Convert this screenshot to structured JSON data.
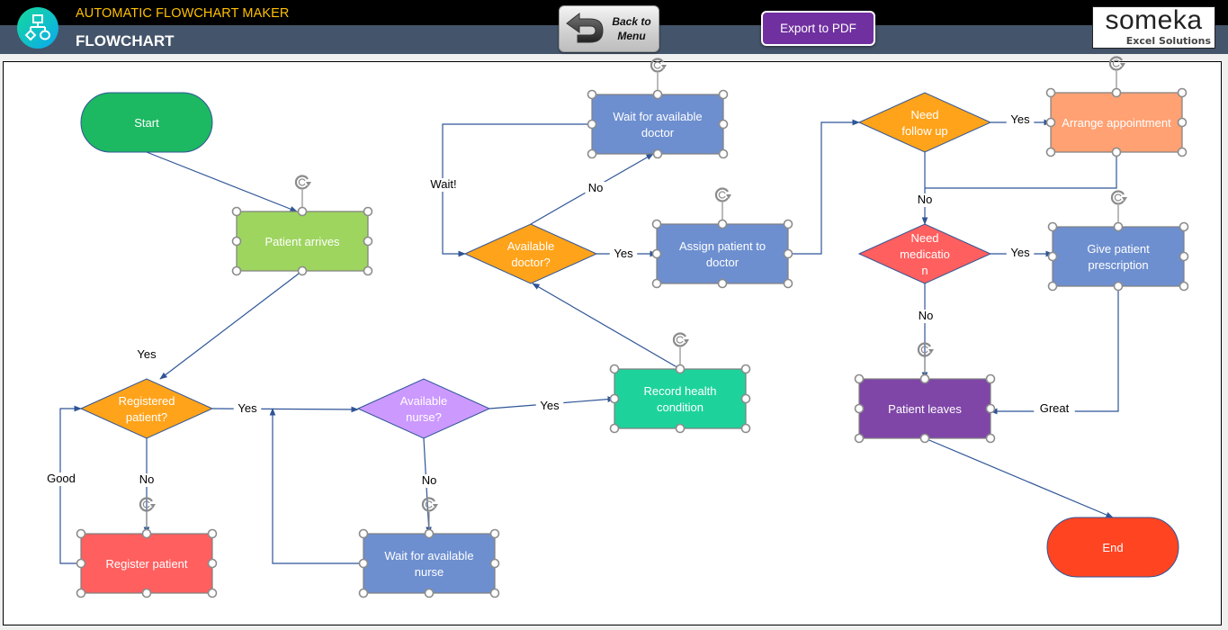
{
  "header": {
    "app_title": "AUTOMATIC FLOWCHART MAKER",
    "page_title": "FLOWCHART",
    "back_button_label": [
      "Back to",
      "Menu"
    ],
    "export_button_label": "Export to PDF",
    "brand_name": "someka",
    "brand_tagline": "Excel Solutions"
  },
  "colors": {
    "green_terminal": "#1db862",
    "light_green": "#9ed55f",
    "orange": "#ffa31a",
    "red": "#ff5f5f",
    "purple_light": "#cc99ff",
    "blue": "#6d8fd0",
    "teal": "#1dd39b",
    "salmon": "#ffa173",
    "purple": "#7f46a8",
    "end_red": "#ff4422",
    "edge": "#2f5597"
  },
  "flowchart": {
    "nodes": [
      {
        "id": "start",
        "type": "terminal",
        "label": [
          "Start"
        ],
        "color": "green_terminal",
        "selected": false
      },
      {
        "id": "patient_arrives",
        "type": "process",
        "label": [
          "Patient arrives"
        ],
        "color": "light_green",
        "selected": true
      },
      {
        "id": "registered",
        "type": "decision",
        "label": [
          "Registered",
          "patient?"
        ],
        "color": "orange",
        "selected": false
      },
      {
        "id": "register_patient",
        "type": "process",
        "label": [
          "Register patient"
        ],
        "color": "red",
        "selected": true
      },
      {
        "id": "avail_nurse",
        "type": "decision",
        "label": [
          "Available",
          "nurse?"
        ],
        "color": "purple_light",
        "selected": false
      },
      {
        "id": "wait_nurse",
        "type": "process",
        "label": [
          "Wait for available",
          "nurse"
        ],
        "color": "blue",
        "selected": true
      },
      {
        "id": "record_health",
        "type": "process",
        "label": [
          "Record health",
          "condition"
        ],
        "color": "teal",
        "selected": true
      },
      {
        "id": "avail_doctor",
        "type": "decision",
        "label": [
          "Available",
          "doctor?"
        ],
        "color": "orange",
        "selected": false
      },
      {
        "id": "wait_doctor",
        "type": "process",
        "label": [
          "Wait for available",
          "doctor"
        ],
        "color": "blue",
        "selected": true
      },
      {
        "id": "assign_doctor",
        "type": "process",
        "label": [
          "Assign patient to",
          "doctor"
        ],
        "color": "blue",
        "selected": true
      },
      {
        "id": "need_followup",
        "type": "decision",
        "label": [
          "Need",
          "follow up"
        ],
        "color": "orange",
        "selected": false
      },
      {
        "id": "arrange_appt",
        "type": "process",
        "label": [
          "Arrange appointment"
        ],
        "color": "salmon",
        "selected": true
      },
      {
        "id": "need_medication",
        "type": "decision",
        "label": [
          "Need",
          "medicatio",
          "n"
        ],
        "color": "red",
        "selected": false
      },
      {
        "id": "give_prescription",
        "type": "process",
        "label": [
          "Give patient",
          "prescription"
        ],
        "color": "blue",
        "selected": true
      },
      {
        "id": "patient_leaves",
        "type": "process",
        "label": [
          "Patient leaves"
        ],
        "color": "purple",
        "selected": true
      },
      {
        "id": "end",
        "type": "terminal",
        "label": [
          "End"
        ],
        "color": "end_red",
        "selected": false
      }
    ],
    "edges": [
      {
        "from": "start",
        "to": "patient_arrives",
        "label": ""
      },
      {
        "from": "patient_arrives",
        "to": "registered",
        "label": "Yes"
      },
      {
        "from": "registered",
        "to": "avail_nurse",
        "label": "Yes"
      },
      {
        "from": "registered",
        "to": "register_patient",
        "label": "No"
      },
      {
        "from": "register_patient",
        "to": "registered",
        "label": "Good"
      },
      {
        "from": "avail_nurse",
        "to": "wait_nurse",
        "label": "No"
      },
      {
        "from": "wait_nurse",
        "to": "avail_nurse",
        "label": ""
      },
      {
        "from": "avail_nurse",
        "to": "record_health",
        "label": "Yes"
      },
      {
        "from": "record_health",
        "to": "avail_doctor",
        "label": ""
      },
      {
        "from": "avail_doctor",
        "to": "wait_doctor",
        "label": "No"
      },
      {
        "from": "wait_doctor",
        "to": "avail_doctor",
        "label": "Wait!"
      },
      {
        "from": "avail_doctor",
        "to": "assign_doctor",
        "label": "Yes"
      },
      {
        "from": "assign_doctor",
        "to": "need_followup",
        "label": ""
      },
      {
        "from": "need_followup",
        "to": "arrange_appt",
        "label": "Yes"
      },
      {
        "from": "need_followup",
        "to": "need_medication",
        "label": "No"
      },
      {
        "from": "arrange_appt",
        "to": "need_medication",
        "label": ""
      },
      {
        "from": "need_medication",
        "to": "give_prescription",
        "label": "Yes"
      },
      {
        "from": "need_medication",
        "to": "patient_leaves",
        "label": "No"
      },
      {
        "from": "give_prescription",
        "to": "patient_leaves",
        "label": "Great"
      },
      {
        "from": "patient_leaves",
        "to": "end",
        "label": ""
      }
    ]
  }
}
